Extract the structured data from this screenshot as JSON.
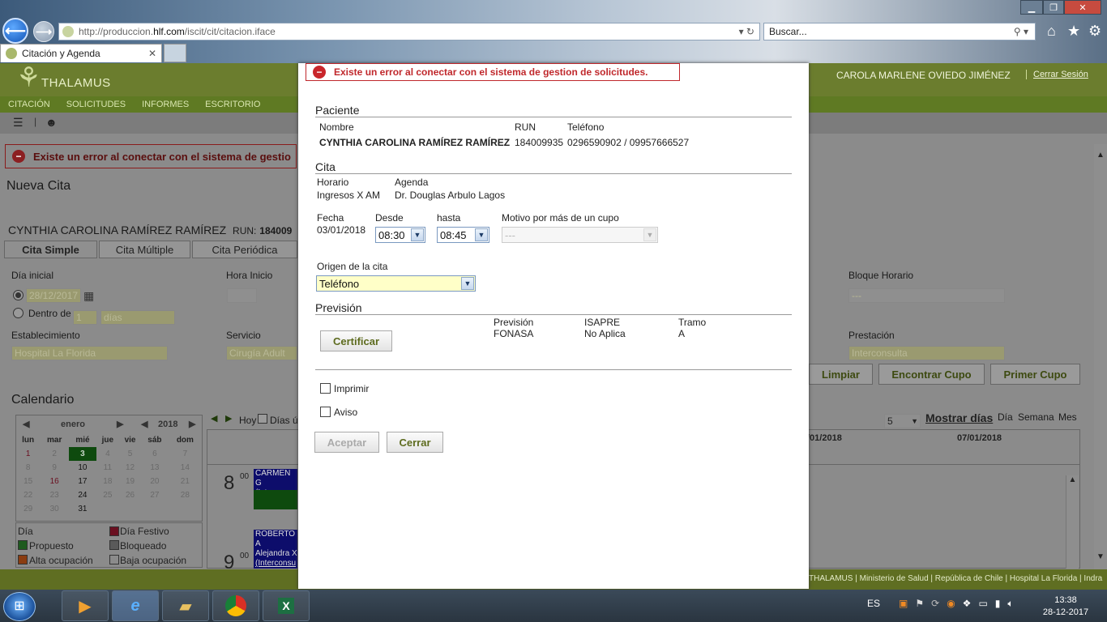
{
  "browser": {
    "url_prefix": "http://produccion.",
    "url_domain": "hlf.com",
    "url_path": "/iscit/cit/citacion.iface",
    "search_placeholder": "Buscar...",
    "tab_title": "Citación y Agenda",
    "tab_close": "✕"
  },
  "app": {
    "logo": "THALAMUS",
    "user_name": "CAROLA MARLENE OVIEDO JIMÉNEZ",
    "logout": "Cerrar Sesión",
    "menu": [
      "CITACIÓN",
      "SOLICITUDES",
      "INFORMES",
      "ESCRITORIO"
    ],
    "error_message": "Existe un error al conectar con el sistema de gestio",
    "page_title": "Nueva Cita",
    "patient_line": "CYNTHIA CAROLINA RAMÍREZ RAMÍREZ",
    "run_label": "RUN:",
    "run_value": "184009",
    "tabs": [
      "Cita Simple",
      "Cita Múltiple",
      "Cita Periódica"
    ],
    "labels": {
      "dia_inicial": "Día inicial",
      "hora_inicio": "Hora Inicio",
      "bloque_horario": "Bloque Horario",
      "dentro_de": "Dentro de",
      "establecimiento": "Establecimiento",
      "servicio": "Servicio",
      "prestacion": "Prestación"
    },
    "values": {
      "fecha": "28/12/2017",
      "dentro_num": "1",
      "dias": "días",
      "establecimiento": "Hospital La Florida",
      "servicio": "Cirugía Adult",
      "bloque": "---",
      "prestacion": "Interconsulta"
    },
    "buttons": {
      "limpiar": "Limpiar",
      "encontrar": "Encontrar Cupo",
      "primer": "Primer Cupo"
    },
    "calendar": {
      "title": "Calendario",
      "month": "enero",
      "year": "2018",
      "weekdays": [
        "lun",
        "mar",
        "mié",
        "jue",
        "vie",
        "sáb",
        "dom"
      ],
      "weeks": [
        [
          "1",
          "2",
          "3",
          "4",
          "5",
          "6",
          "7"
        ],
        [
          "8",
          "9",
          "10",
          "11",
          "12",
          "13",
          "14"
        ],
        [
          "15",
          "16",
          "17",
          "18",
          "19",
          "20",
          "21"
        ],
        [
          "22",
          "23",
          "24",
          "25",
          "26",
          "27",
          "28"
        ],
        [
          "29",
          "30",
          "31",
          "",
          "",
          "",
          ""
        ]
      ],
      "hoy": "Hoy",
      "dias_utiles": "Días ú",
      "num_days": "5",
      "mostrar_dias": "Mostrar días",
      "views": [
        "Día",
        "Semana",
        "Mes"
      ],
      "col_dates": [
        "/01/2018",
        "07/01/2018"
      ],
      "hours": [
        "8",
        "9"
      ],
      "minutes": "00",
      "appointments": [
        {
          "name": "CARMEN G",
          "type": "(Interconsu"
        },
        {
          "name": "ROBERTO A",
          "type": "(Interconsu"
        },
        {
          "name": "Alejandra X",
          "type": "(Interconsu"
        }
      ]
    },
    "legend": {
      "title": "Día",
      "festivo": "Día Festivo",
      "propuesto": "Propuesto",
      "bloqueado": "Bloqueado",
      "alta": "Alta ocupación",
      "baja": "Baja ocupación"
    },
    "footer": "THALAMUS | Ministerio de Salud | República de Chile | Hospital La Florida | Indra"
  },
  "modal": {
    "error": "Existe un error al conectar con el sistema de gestion de solicitudes.",
    "paciente_title": "Paciente",
    "nombre_label": "Nombre",
    "run_label": "RUN",
    "telefono_label": "Teléfono",
    "nombre": "CYNTHIA CAROLINA RAMÍREZ RAMÍREZ",
    "run": "184009935",
    "telefono": "0296590902 / 09957666527",
    "cita_title": "Cita",
    "horario_label": "Horario",
    "agenda_label": "Agenda",
    "horario": "Ingresos X AM",
    "agenda": "Dr. Douglas Arbulo Lagos",
    "fecha_label": "Fecha",
    "desde_label": "Desde",
    "hasta_label": "hasta",
    "motivo_label": "Motivo por más de un cupo",
    "fecha": "03/01/2018",
    "desde": "08:30",
    "hasta": "08:45",
    "motivo": "---",
    "origen_label": "Origen de la cita",
    "origen": "Teléfono",
    "prevision_title": "Previsión",
    "certificar": "Certificar",
    "prevision_label": "Previsión",
    "isapre_label": "ISAPRE",
    "tramo_label": "Tramo",
    "prevision": "FONASA",
    "isapre": "No Aplica",
    "tramo": "A",
    "imprimir": "Imprimir",
    "aviso": "Aviso",
    "aceptar": "Aceptar",
    "cerrar": "Cerrar"
  },
  "taskbar": {
    "lang": "ES",
    "time": "13:38",
    "date": "28-12-2017"
  },
  "colors": {
    "app_header": "#6b7d2e",
    "error_red": "#c0282c",
    "select_yellow": "#ffffc8"
  }
}
